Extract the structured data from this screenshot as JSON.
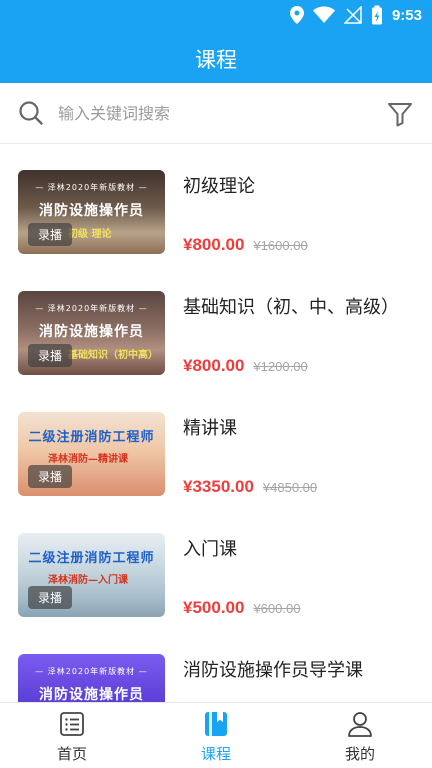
{
  "status_bar": {
    "time": "9:53"
  },
  "header": {
    "title": "课程"
  },
  "search": {
    "placeholder": "输入关键词搜索"
  },
  "courses": [
    {
      "title": "初级理论",
      "price": "¥800.00",
      "original_price": "¥1600.00",
      "tag": "录播",
      "thumb_top": "— 泽林2020年新版教材 —",
      "thumb_main": "消防设施操作员",
      "thumb_sub": "初级 理论",
      "thumb_bg": "#5b4a3f",
      "thumb_fg": "#ffffff",
      "sub_color": "#f2e25b"
    },
    {
      "title": "基础知识（初、中、高级）",
      "price": "¥800.00",
      "original_price": "¥1200.00",
      "tag": "录播",
      "thumb_top": "— 泽林2020年新版教材 —",
      "thumb_main": "消防设施操作员",
      "thumb_sub": "基础知识（初中高）",
      "thumb_bg": "#6b5650",
      "thumb_fg": "#ffffff",
      "sub_color": "#f2e25b"
    },
    {
      "title": "精讲课",
      "price": "¥3350.00",
      "original_price": "¥4850.00",
      "tag": "录播",
      "thumb_top": "",
      "thumb_main": "二级注册消防工程师",
      "thumb_sub": "泽林消防—精讲课",
      "thumb_bg": "#e9c9b0",
      "thumb_fg": "#1e5fc8",
      "sub_color": "#d4341f"
    },
    {
      "title": "入门课",
      "price": "¥500.00",
      "original_price": "¥600.00",
      "tag": "录播",
      "thumb_top": "",
      "thumb_main": "二级注册消防工程师",
      "thumb_sub": "泽林消防—入门课",
      "thumb_bg": "#c9d9e2",
      "thumb_fg": "#1e5fc8",
      "sub_color": "#d4341f"
    },
    {
      "title": "消防设施操作员导学课",
      "price": "",
      "original_price": "",
      "tag": "",
      "thumb_top": "— 泽林2020年新版教材 —",
      "thumb_main": "消防设施操作员",
      "thumb_sub": "",
      "thumb_bg": "#5a3ed6",
      "thumb_fg": "#ffffff",
      "sub_color": "#ffffff"
    }
  ],
  "bottom_nav": [
    {
      "label": "首页",
      "icon": "home-list-icon",
      "active": false
    },
    {
      "label": "课程",
      "icon": "course-book-icon",
      "active": true
    },
    {
      "label": "我的",
      "icon": "profile-user-icon",
      "active": false
    }
  ],
  "colors": {
    "primary": "#1aa3f3",
    "price": "#f03c3c",
    "strike": "#a5a5a5"
  }
}
